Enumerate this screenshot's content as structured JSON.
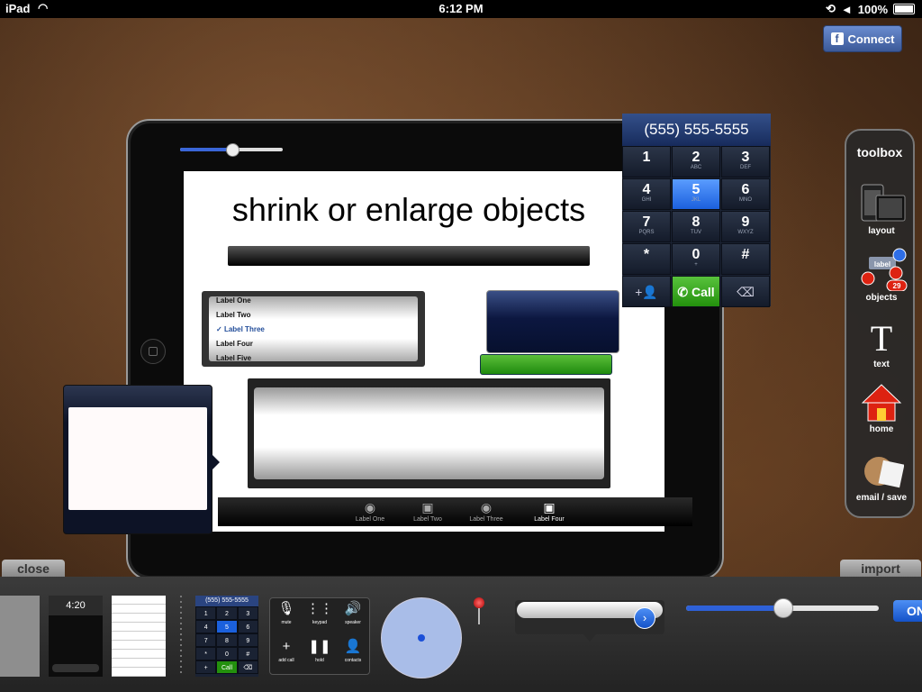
{
  "status_bar": {
    "device": "iPad",
    "time": "6:12 PM",
    "battery": "100%"
  },
  "facebook": {
    "label": "Connect"
  },
  "canvas": {
    "headline": "shrink or enlarge objects",
    "slider_value": 0.5,
    "picker_items": [
      "Label One",
      "Label Two",
      "Label Three",
      "Label Four",
      "Label Five"
    ],
    "picker_selected": "Label Three",
    "tab_items": [
      {
        "label": "Label One",
        "icon": "record-icon"
      },
      {
        "label": "Label Two",
        "icon": "monitor-icon"
      },
      {
        "label": "Label Three",
        "icon": "record-icon"
      },
      {
        "label": "Label Four",
        "icon": "monitor-icon"
      }
    ]
  },
  "keypad": {
    "number": "(555) 555-5555",
    "keys": [
      {
        "digit": "1",
        "letters": ""
      },
      {
        "digit": "2",
        "letters": "ABC"
      },
      {
        "digit": "3",
        "letters": "DEF"
      },
      {
        "digit": "4",
        "letters": "GHI"
      },
      {
        "digit": "5",
        "letters": "JKL"
      },
      {
        "digit": "6",
        "letters": "MNO"
      },
      {
        "digit": "7",
        "letters": "PQRS"
      },
      {
        "digit": "8",
        "letters": "TUV"
      },
      {
        "digit": "9",
        "letters": "WXYZ"
      },
      {
        "digit": "*",
        "letters": ""
      },
      {
        "digit": "0",
        "letters": "+"
      },
      {
        "digit": "#",
        "letters": ""
      }
    ],
    "call_label": "Call"
  },
  "toolbox": {
    "title": "toolbox",
    "tools": [
      {
        "label": "layout",
        "icon": "devices-icon"
      },
      {
        "label": "objects",
        "icon": "objects-icon"
      },
      {
        "label": "text",
        "icon": "text-icon"
      },
      {
        "label": "home",
        "icon": "home-icon"
      },
      {
        "label": "email / save",
        "icon": "email-save-icon"
      }
    ],
    "objects_badge": "29",
    "objects_label_text": "label"
  },
  "bottom": {
    "close_label": "close",
    "import_label": "import",
    "lock_time": "4:20",
    "mini_number": "(555) 555-5555",
    "mini_keys": [
      "1",
      "2",
      "3",
      "4",
      "5",
      "6",
      "7",
      "8",
      "9",
      "*",
      "0",
      "#"
    ],
    "mini_call": "Call",
    "call_panel": [
      "mute",
      "keypad",
      "speaker",
      "add call",
      "hold",
      "contacts"
    ],
    "slider_value": 0.5,
    "switch_label": "ON"
  },
  "colors": {
    "accent": "#2e61d8",
    "call_green": "#23900d",
    "facebook": "#3b5998"
  }
}
